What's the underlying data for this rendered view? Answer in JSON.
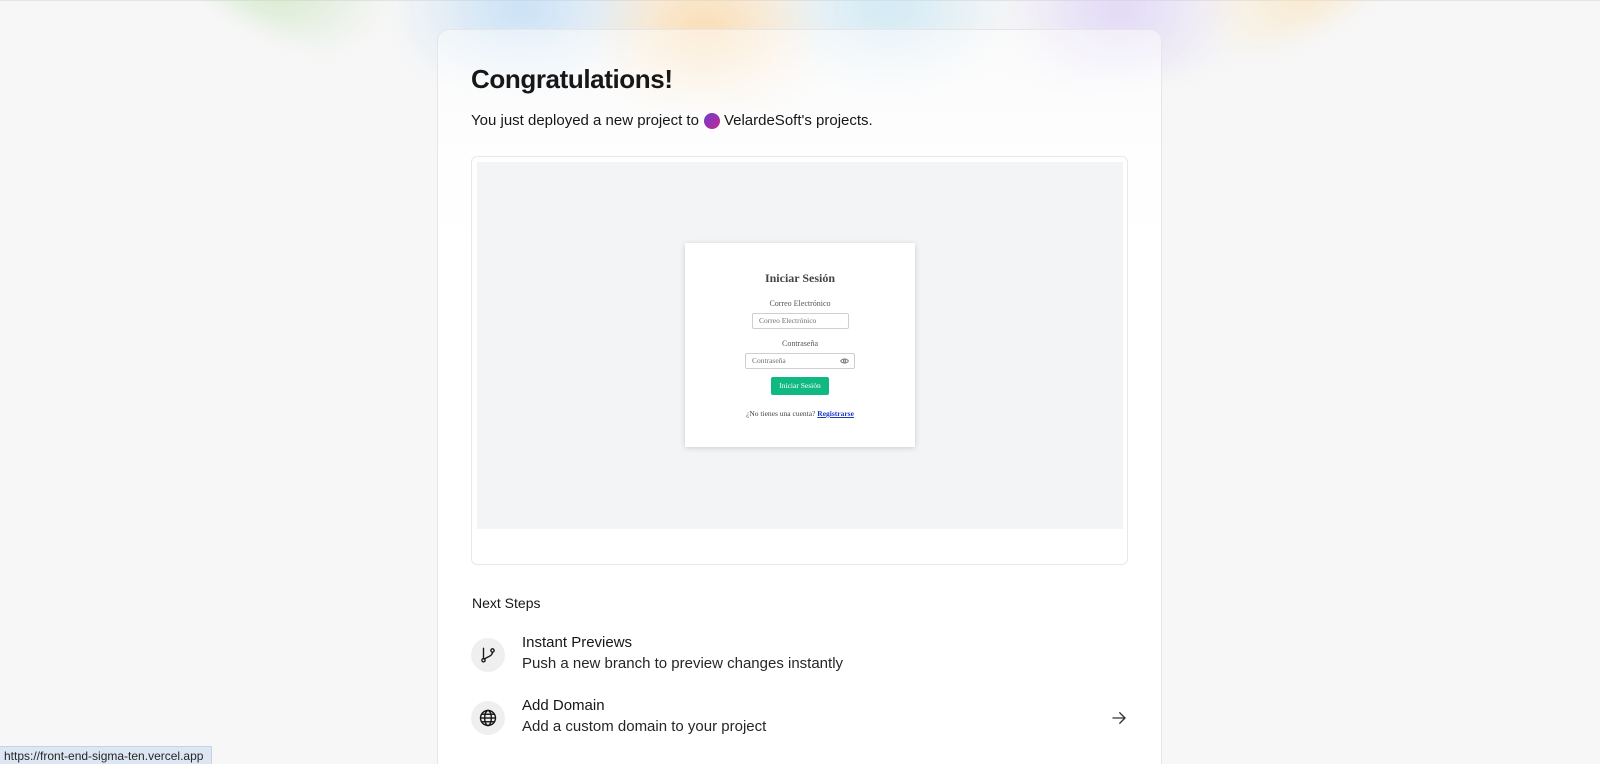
{
  "header": {
    "title": "Congratulations!",
    "subtitle_prefix": "You just deployed a new project to",
    "team_name": "VelardeSoft's projects."
  },
  "preview": {
    "login": {
      "title": "Iniciar Sesión",
      "email_label": "Correo Electrónico",
      "email_placeholder": "Correo Electrónico",
      "password_label": "Contraseña",
      "password_placeholder": "Contraseña",
      "submit_label": "Iniciar Sesión",
      "no_account_text": "¿No tienes una cuenta?",
      "register_link": "Registrarse"
    }
  },
  "next_steps": {
    "label": "Next Steps",
    "items": [
      {
        "title": "Instant Previews",
        "description": "Push a new branch to preview changes instantly",
        "icon": "git-branch-icon"
      },
      {
        "title": "Add Domain",
        "description": "Add a custom domain to your project",
        "icon": "globe-icon"
      }
    ]
  },
  "status_bar": {
    "url": "https://front-end-sigma-ten.vercel.app"
  },
  "colors": {
    "accent_green": "#10b981",
    "team_avatar_start": "#6f3ccf",
    "team_avatar_end": "#c2298c",
    "link_blue": "#1d39c4"
  }
}
